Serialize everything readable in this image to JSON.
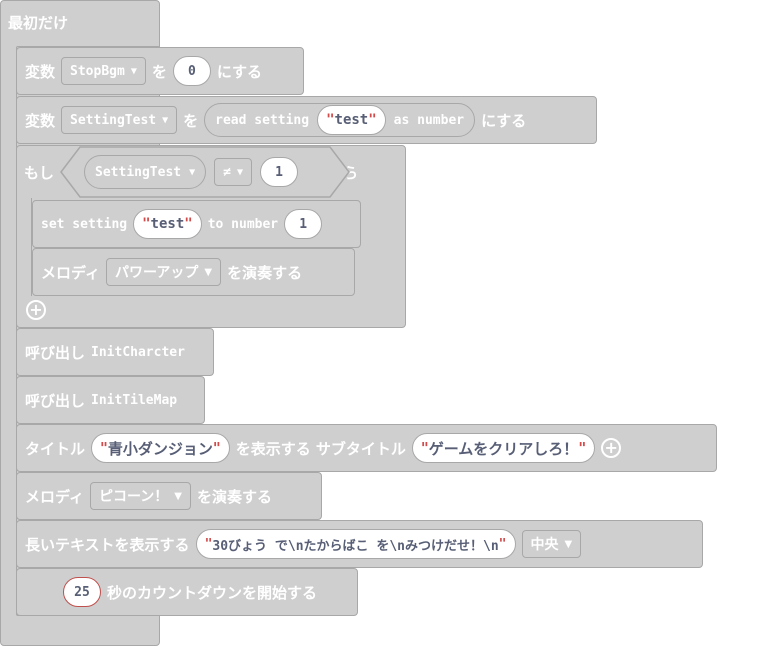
{
  "start_block": {
    "label": "最初だけ"
  },
  "blocks": {
    "set_stopbgm": {
      "prefix": "変数",
      "var": "StopBgm",
      "to": "を",
      "value": "0",
      "suffix": "にする"
    },
    "set_settingtest": {
      "prefix": "変数",
      "var": "SettingTest",
      "to": "を",
      "read_pre": "read setting",
      "key": "test",
      "read_post": "as number",
      "suffix": "にする"
    },
    "if_block": {
      "if_label": "もし",
      "var": "SettingTest",
      "op": "≠",
      "value": "1",
      "then_label": "なら"
    },
    "set_setting": {
      "pre": "set setting",
      "key": "test",
      "mid": "to number",
      "value": "1"
    },
    "melody1": {
      "prefix": "メロディ",
      "tune": "パワーアップ",
      "suffix": "を演奏する"
    },
    "call1": {
      "prefix": "呼び出し",
      "func": "InitCharcter"
    },
    "call2": {
      "prefix": "呼び出し",
      "func": "InitTileMap"
    },
    "title": {
      "prefix": "タイトル",
      "title": "青小ダンジョン",
      "mid": "を表示する サブタイトル",
      "subtitle": "ゲームをクリアしろ！"
    },
    "melody2": {
      "prefix": "メロディ",
      "tune": "ピコーン！",
      "suffix": "を演奏する"
    },
    "longtext": {
      "prefix": "長いテキストを表示する",
      "text": "30びょう で\\nたからばこ を\\nみつけだせ！\\n",
      "align": "中央"
    },
    "countdown": {
      "value": "25",
      "suffix": "秒のカウントダウンを開始する"
    }
  },
  "quote_char": "\""
}
